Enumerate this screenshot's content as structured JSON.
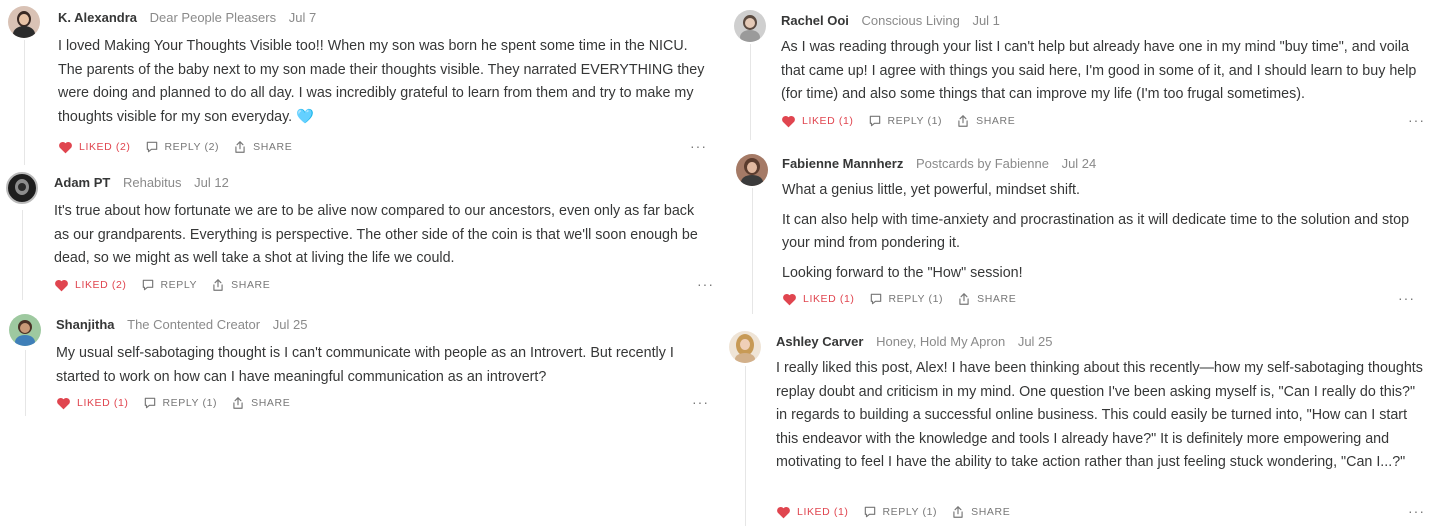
{
  "actions": {
    "reply": "REPLY",
    "share": "SHARE",
    "more": "···"
  },
  "colors": {
    "liked": "#e0454f",
    "text": "#363737",
    "muted": "#8a8a8a"
  },
  "comments": [
    {
      "author": "K. Alexandra",
      "publication": "Dear People Pleasers",
      "date": "Jul 7",
      "paragraphs": [
        "I loved Making Your Thoughts Visible too!! When my son was born he spent some time in the NICU. The parents of the baby next to my son made their thoughts visible. They narrated EVERYTHING they were doing and planned to do all day. I was incredibly grateful to learn from them and try to make my thoughts visible for my son everyday. 🩵"
      ],
      "liked": "LIKED (2)",
      "reply": "REPLY (2)"
    },
    {
      "author": "Adam PT",
      "publication": "Rehabitus",
      "date": "Jul 12",
      "paragraphs": [
        "It's true about how fortunate we are to be alive now compared to our ancestors, even only as far back as our grandparents. Everything is perspective. The other side of the coin is that we'll soon enough be dead, so we might as well take a shot at living the life we could."
      ],
      "liked": "LIKED (2)",
      "reply": "REPLY"
    },
    {
      "author": "Shanjitha",
      "publication": "The Contented Creator",
      "date": "Jul 25",
      "paragraphs": [
        "My usual self-sabotaging thought is I can't communicate with people as an Introvert. But recently I started to work on how can I have meaningful communication as an introvert?"
      ],
      "liked": "LIKED (1)",
      "reply": "REPLY (1)"
    },
    {
      "author": "Rachel Ooi",
      "publication": "Conscious Living",
      "date": "Jul 1",
      "paragraphs": [
        "As I was reading through your list I can't help but already have one in my mind \"buy time\", and voila that came up! I agree with things you said here, I'm good in some of it, and I should learn to buy help (for time) and also some things that can improve my life (I'm too frugal sometimes)."
      ],
      "liked": "LIKED (1)",
      "reply": "REPLY (1)"
    },
    {
      "author": "Fabienne Mannherz",
      "publication": "Postcards by Fabienne",
      "date": "Jul 24",
      "paragraphs": [
        "What a genius little, yet powerful, mindset shift.",
        "It can also help with time-anxiety and procrastination as it will dedicate time to the solution and stop your mind from pondering it.",
        "Looking forward to the \"How\" session!"
      ],
      "liked": "LIKED (1)",
      "reply": "REPLY (1)"
    },
    {
      "author": "Ashley Carver",
      "publication": "Honey, Hold My Apron",
      "date": "Jul 25",
      "paragraphs": [
        "I really liked this post, Alex! I have been thinking about this recently—how my self-sabotaging thoughts replay doubt and criticism in my mind. One question I've been asking myself is, \"Can I really do this?\" in regards to building a successful online business. This could easily be turned into, \"How can I start this endeavor with the knowledge and tools I already have?\" It is definitely more empowering and motivating to feel I have the ability to take action rather than just feeling stuck wondering, \"Can I...?\""
      ],
      "liked": "LIKED (1)",
      "reply": "REPLY (1)"
    }
  ]
}
